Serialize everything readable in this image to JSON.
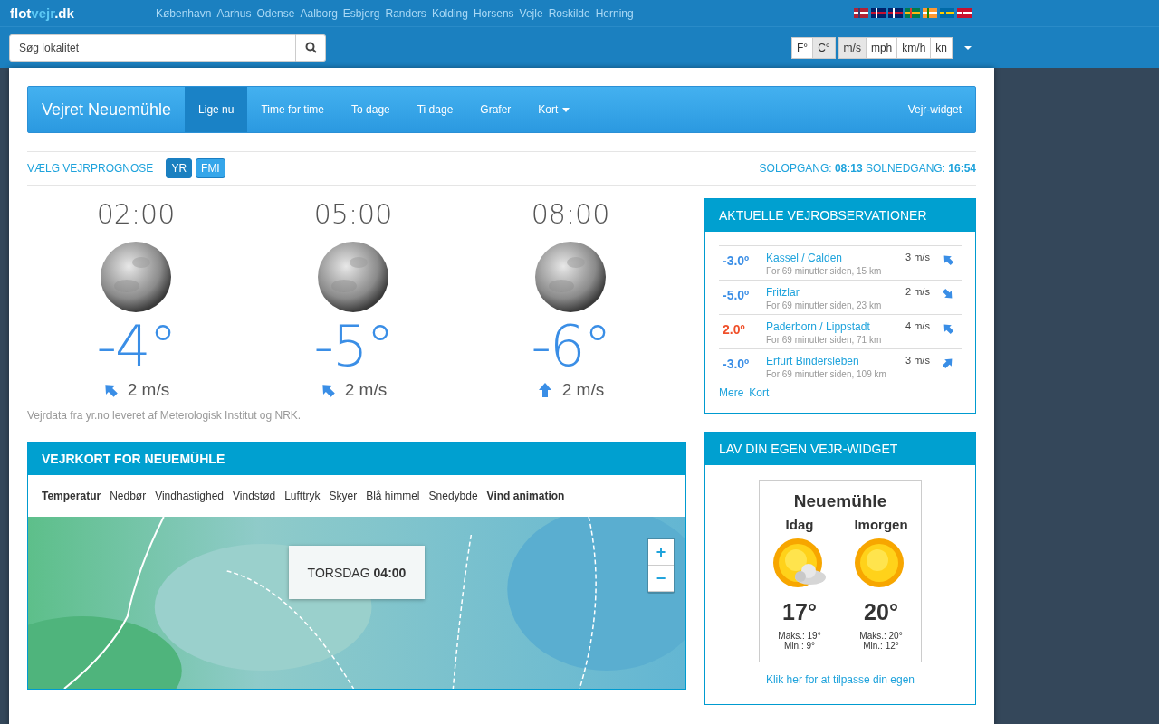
{
  "header": {
    "logo": {
      "part_1": "flot",
      "part_2": "vejr",
      "part_3": ".dk"
    },
    "cities": [
      "København",
      "Aarhus",
      "Odense",
      "Aalborg",
      "Esbjerg",
      "Randers",
      "Kolding",
      "Horsens",
      "Vejle",
      "Roskilde",
      "Herning"
    ],
    "search": {
      "placeholder": "Søg lokalitet"
    },
    "temp_units": [
      {
        "label": "F°",
        "selected": false
      },
      {
        "label": "C°",
        "selected": true
      }
    ],
    "wind_units": [
      {
        "label": "m/s",
        "selected": true
      },
      {
        "label": "mph",
        "selected": false
      },
      {
        "label": "km/h",
        "selected": false
      },
      {
        "label": "kn",
        "selected": false
      }
    ]
  },
  "navbar": {
    "title": "Vejret Neuemühle",
    "tabs": [
      {
        "label": "Lige nu",
        "selected": true
      },
      {
        "label": "Time for time",
        "selected": false
      },
      {
        "label": "To dage",
        "selected": false
      },
      {
        "label": "Ti dage",
        "selected": false
      },
      {
        "label": "Grafer",
        "selected": false
      },
      {
        "label": "Kort",
        "selected": false,
        "dropdown": true
      }
    ],
    "widget_link": "Vejr-widget"
  },
  "forecast_choice": {
    "label": "VÆLG VEJRPROGNOSE",
    "sources": [
      {
        "label": "YR",
        "selected": true
      },
      {
        "label": "FMI",
        "selected": false
      }
    ],
    "sunrise_label": "SOLOPGANG:",
    "sunrise": "08:13",
    "sunset_label": "SOLNEDGANG:",
    "sunset": "16:54"
  },
  "forecast": [
    {
      "time": "02:00",
      "temp": "-4°",
      "wind": "2 m/s",
      "kind": "nw"
    },
    {
      "time": "05:00",
      "temp": "-5°",
      "wind": "2 m/s",
      "kind": "nw"
    },
    {
      "time": "08:00",
      "temp": "-6°",
      "wind": "2 m/s",
      "kind": "n"
    }
  ],
  "credit": "Vejrdata fra yr.no leveret af Meterologisk Institut og NRK.",
  "map": {
    "title": "VEJRKORT FOR NEUEMÜHLE",
    "layers": [
      {
        "label": "Temperatur",
        "selected": true
      },
      {
        "label": "Nedbør",
        "selected": false
      },
      {
        "label": "Vindhastighed",
        "selected": false
      },
      {
        "label": "Vindstød",
        "selected": false
      },
      {
        "label": "Lufttryk",
        "selected": false
      },
      {
        "label": "Skyer",
        "selected": false
      },
      {
        "label": "Blå himmel",
        "selected": false
      },
      {
        "label": "Snedybde",
        "selected": false
      },
      {
        "label": "Vind animation",
        "selected": true
      }
    ],
    "time_day": "TORSDAG",
    "time_hour": "04:00",
    "zoom_in": "+",
    "zoom_out": "−"
  },
  "observations": {
    "title": "AKTUELLE VEJROBSERVATIONER",
    "rows": [
      {
        "temp": "-3.0º",
        "color": "#3a8ee6",
        "station": "Kassel / Calden",
        "detail": "For 69 minutter siden, 15 km",
        "wind": "3 m/s",
        "kind": "nw"
      },
      {
        "temp": "-5.0º",
        "color": "#3a8ee6",
        "station": "Fritzlar",
        "detail": "For 69 minutter siden, 23 km",
        "wind": "2 m/s",
        "kind": "se"
      },
      {
        "temp": "2.0º",
        "color": "#f0502a",
        "station": "Paderborn / Lippstadt",
        "detail": "For 69 minutter siden, 71 km",
        "wind": "4 m/s",
        "kind": "nw"
      },
      {
        "temp": "-3.0º",
        "color": "#3a8ee6",
        "station": "Erfurt Bindersleben",
        "detail": "For 69 minutter siden, 109 km",
        "wind": "3 m/s",
        "kind": "ne"
      }
    ],
    "links": [
      "Mere",
      "Kort"
    ]
  },
  "widget": {
    "title": "LAV DIN EGEN VEJR-WIDGET",
    "place": "Neuemühle",
    "days": [
      {
        "label": "Idag",
        "kind": "partly_cloudy",
        "temp": "17°",
        "max": "Maks.: 19°",
        "min": "Min.: 9°"
      },
      {
        "label": "Imorgen",
        "kind": "sunny",
        "temp": "20°",
        "max": "Maks.: 20°",
        "min": "Min.: 12°"
      }
    ],
    "link": "Klik her for at tilpasse din egen"
  }
}
